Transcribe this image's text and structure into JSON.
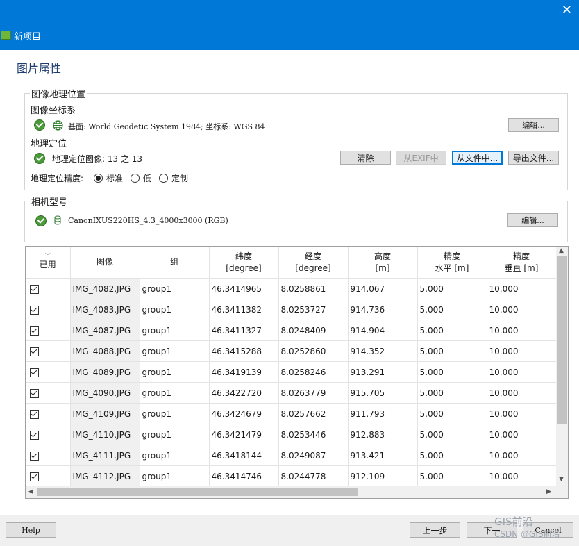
{
  "window": {
    "title": "新项目",
    "close": "✕"
  },
  "page_title": "图片属性",
  "geolocation": {
    "group_label": "图像地理位置",
    "crs_label": "图像坐标系",
    "crs_value": "基面: World Geodetic System 1984; 坐标系: WGS 84",
    "crs_edit": "编辑...",
    "geo_label": "地理定位",
    "geo_status": "地理定位图像: 13 之 13",
    "clear": "清除",
    "from_exif": "从EXIF中",
    "from_file": "从文件中...",
    "export_file": "导出文件...",
    "accuracy_label": "地理定位精度:",
    "accuracy_options": [
      "标准",
      "低",
      "定制"
    ],
    "accuracy_selected": "标准"
  },
  "camera": {
    "group_label": "相机型号",
    "model": "CanonIXUS220HS_4.3_4000x3000 (RGB)",
    "edit": "编辑..."
  },
  "table": {
    "headers": [
      "已用",
      "图像",
      "组",
      "纬度\n[degree]",
      "经度\n[degree]",
      "高度\n[m]",
      "精度\n水平 [m]",
      "精度\n垂直 [m]"
    ],
    "rows": [
      {
        "used": true,
        "image": "IMG_4082.JPG",
        "group": "group1",
        "lat": "46.3414965",
        "lon": "8.0258861",
        "alt": "914.067",
        "h_acc": "5.000",
        "v_acc": "10.000"
      },
      {
        "used": true,
        "image": "IMG_4083.JPG",
        "group": "group1",
        "lat": "46.3411382",
        "lon": "8.0253727",
        "alt": "914.736",
        "h_acc": "5.000",
        "v_acc": "10.000"
      },
      {
        "used": true,
        "image": "IMG_4087.JPG",
        "group": "group1",
        "lat": "46.3411327",
        "lon": "8.0248409",
        "alt": "914.904",
        "h_acc": "5.000",
        "v_acc": "10.000"
      },
      {
        "used": true,
        "image": "IMG_4088.JPG",
        "group": "group1",
        "lat": "46.3415288",
        "lon": "8.0252860",
        "alt": "914.352",
        "h_acc": "5.000",
        "v_acc": "10.000"
      },
      {
        "used": true,
        "image": "IMG_4089.JPG",
        "group": "group1",
        "lat": "46.3419139",
        "lon": "8.0258246",
        "alt": "913.291",
        "h_acc": "5.000",
        "v_acc": "10.000"
      },
      {
        "used": true,
        "image": "IMG_4090.JPG",
        "group": "group1",
        "lat": "46.3422720",
        "lon": "8.0263779",
        "alt": "915.705",
        "h_acc": "5.000",
        "v_acc": "10.000"
      },
      {
        "used": true,
        "image": "IMG_4109.JPG",
        "group": "group1",
        "lat": "46.3424679",
        "lon": "8.0257662",
        "alt": "911.793",
        "h_acc": "5.000",
        "v_acc": "10.000"
      },
      {
        "used": true,
        "image": "IMG_4110.JPG",
        "group": "group1",
        "lat": "46.3421479",
        "lon": "8.0253446",
        "alt": "912.883",
        "h_acc": "5.000",
        "v_acc": "10.000"
      },
      {
        "used": true,
        "image": "IMG_4111.JPG",
        "group": "group1",
        "lat": "46.3418144",
        "lon": "8.0249087",
        "alt": "913.421",
        "h_acc": "5.000",
        "v_acc": "10.000"
      },
      {
        "used": true,
        "image": "IMG_4112.JPG",
        "group": "group1",
        "lat": "46.3414746",
        "lon": "8.0244778",
        "alt": "912.109",
        "h_acc": "5.000",
        "v_acc": "10.000"
      }
    ]
  },
  "footer": {
    "help": "Help",
    "prev": "上一步",
    "next": "下一",
    "cancel": "Cancel"
  },
  "watermark": {
    "line1": "GIS前沿",
    "line2": "CSDN @GIS前沿"
  },
  "colors": {
    "titlebar": "#0078d7",
    "ok": "#4a9a3a"
  }
}
